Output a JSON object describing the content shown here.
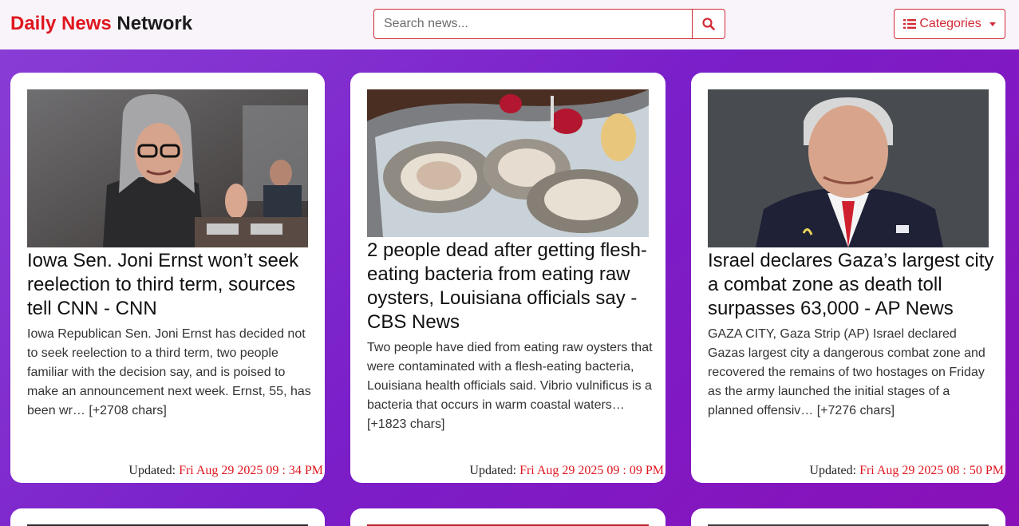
{
  "brand": {
    "part1": "Daily News",
    "part2": "Network"
  },
  "search": {
    "placeholder": "Search news...",
    "icon": "search-icon"
  },
  "categories": {
    "label": "Categories",
    "icon": "list-icon"
  },
  "updated_label": "Updated:",
  "articles": [
    {
      "title": "Iowa Sen. Joni Ernst won’t seek reelection to third term, sources tell CNN - CNN",
      "description": "Iowa Republican Sen. Joni Ernst has decided not to seek reelection to a third term, two people familiar with the decision say, and is poised to make an announcement next week. Ernst, 55, has been wr… [+2708 chars]",
      "updated": "Fri Aug 29 2025 09 : 34 PM"
    },
    {
      "title": "2 people dead after getting flesh-eating bacteria from eating raw oysters, Louisiana officials say - CBS News",
      "description": "Two people have died from eating raw oysters that were contaminated with a flesh-eating bacteria, Louisiana health officials said.  Vibrio vulnificus is a bacteria that occurs in warm coastal waters… [+1823 chars]",
      "updated": "Fri Aug 29 2025 09 : 09 PM"
    },
    {
      "title": "Israel declares Gaza’s largest city a combat zone as death toll surpasses 63,000 - AP News",
      "description": "GAZA CITY, Gaza Strip (AP) Israel declared Gazas largest city a dangerous combat zone and recovered the remains of two hostages on Friday as the army launched the initial stages of a planned offensiv… [+7276 chars]",
      "updated": "Fri Aug 29 2025 08 : 50 PM"
    }
  ]
}
